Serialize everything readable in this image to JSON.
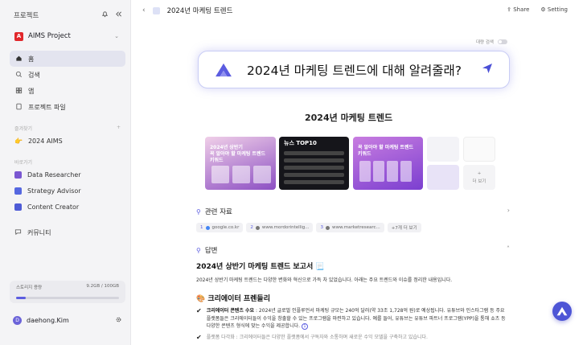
{
  "sidebar": {
    "title": "프로젝트",
    "project_name": "AIMS Project",
    "project_logo": "A",
    "nav": [
      {
        "label": "홈",
        "icon": "home-icon",
        "active": true
      },
      {
        "label": "검색",
        "icon": "search-icon"
      },
      {
        "label": "앱",
        "icon": "apps-icon"
      },
      {
        "label": "프로젝트 파일",
        "icon": "file-icon"
      }
    ],
    "section_favorites": "즐겨찾기",
    "favorite_item": "2024 AIMS",
    "section_assistants": "바로가기",
    "assistants": [
      {
        "label": "Data Researcher",
        "color": "#7a57d1"
      },
      {
        "label": "Strategy Advisor",
        "color": "#5567e0"
      },
      {
        "label": "Content Creator",
        "color": "#4e5bd6"
      }
    ],
    "community": "커뮤니티",
    "storage_label": "스토리지 용량",
    "storage_value": "9.2GB / 100GB",
    "storage_fraction": 0.092,
    "user_name": "daehong.Kim",
    "user_initial": "D"
  },
  "topbar": {
    "title": "2024년 마케팅 트렌드",
    "share": "Share",
    "setting": "Setting"
  },
  "toggle_label": "대량 검색",
  "query": "2024년 마케팅 트렌드에 대해 알려줄래?",
  "heading": "2024년 마케팅 트렌드",
  "thumbs": {
    "t1": "2024년 상반기\n꼭 알아야 할 마케팅 트렌드 키워드",
    "t2": "뉴스 TOP10",
    "t3": "꼭 알아야 할 마케팅 트렌드 키워드",
    "more": "더 보기"
  },
  "related": {
    "title": "관련 자료",
    "sources": [
      {
        "n": "1",
        "label": "google.co.kr"
      },
      {
        "n": "2",
        "label": "www.mordorintellig..."
      },
      {
        "n": "3",
        "label": "www.marketresearc..."
      }
    ],
    "more": "+7개 더 보기"
  },
  "answer": {
    "title": "답변",
    "heading": "2024년 상반기 마케팅 트렌드 보고서 📃",
    "intro": "2024년 상반기 마케팅 트렌드는 다양한 변화와 혁신으로 가득 차 있었습니다. 아래는 주요 트렌드와 이슈를 정리한 내용입니다.",
    "subheading": "🎨 크리에이터 프렌들리",
    "bullet1_bold": "크리에이터 콘텐츠 수요",
    "bullet1_text": " : 2024년 글로벌 인플루언서 마케팅 규모는 240억 달러(약 33조 1,728억 원)로 예상됩니다. 유튜브와 인스타그램 등 주요 플랫폼들은 크리에이터들이 수익을 창출할 수 있는 프로그램을 마련하고 있습니다. 예를 들어, 유튜브는 유튜브 파트너 프로그램(YPP)을 통해 쇼츠 등 다양한 콘텐츠 형식에 맞는 수익을 제공합니다.",
    "bullet1_cite": "1",
    "bullet2_text": "플랫폼 다각화 : 크리에이터들은 다양한 플랫폼에서 구독자와 소통하며 새로운 수익 모델을 구축하고 있습니다."
  },
  "colors": {
    "accent": "#5b5ce0",
    "sidebar_bg": "#f4f4f6"
  }
}
